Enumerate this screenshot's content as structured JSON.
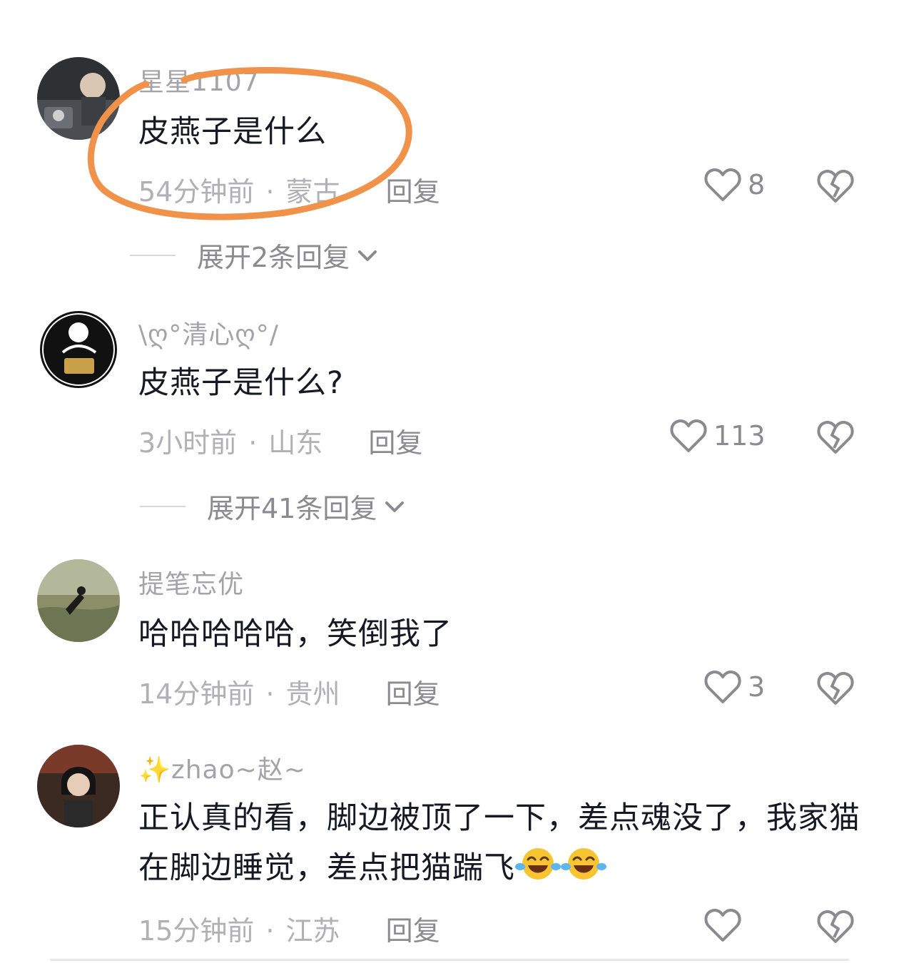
{
  "comments": [
    {
      "username": "星星1107",
      "text": "皮燕子是什么",
      "time": "54分钟前",
      "location": "蒙古",
      "reply_label": "回复",
      "likes": "8",
      "expand_label": "展开2条回复"
    },
    {
      "username": "\\ღ°清心ღ°/",
      "text": "皮燕子是什么?",
      "time": "3小时前",
      "location": "山东",
      "reply_label": "回复",
      "likes": "113",
      "expand_label": "展开41条回复"
    },
    {
      "username": "提笔忘优",
      "text": "哈哈哈哈哈，笑倒我了",
      "time": "14分钟前",
      "location": "贵州",
      "reply_label": "回复",
      "likes": "3"
    },
    {
      "username": "✨zhao~赵~",
      "text": "正认真的看，脚边被顶了一下，差点魂没了，我家猫在脚边睡觉，差点把猫踹飞",
      "time": "15分钟前",
      "location": "江苏",
      "reply_label": "回复",
      "likes": ""
    }
  ],
  "colors": {
    "annotation_circle": "#F0924A",
    "meta_text": "#B0B0B5",
    "primary_text": "#161823"
  },
  "icons": [
    "heart-outline-icon",
    "broken-heart-icon",
    "chevron-down-icon",
    "laughing-crying-emoji"
  ]
}
